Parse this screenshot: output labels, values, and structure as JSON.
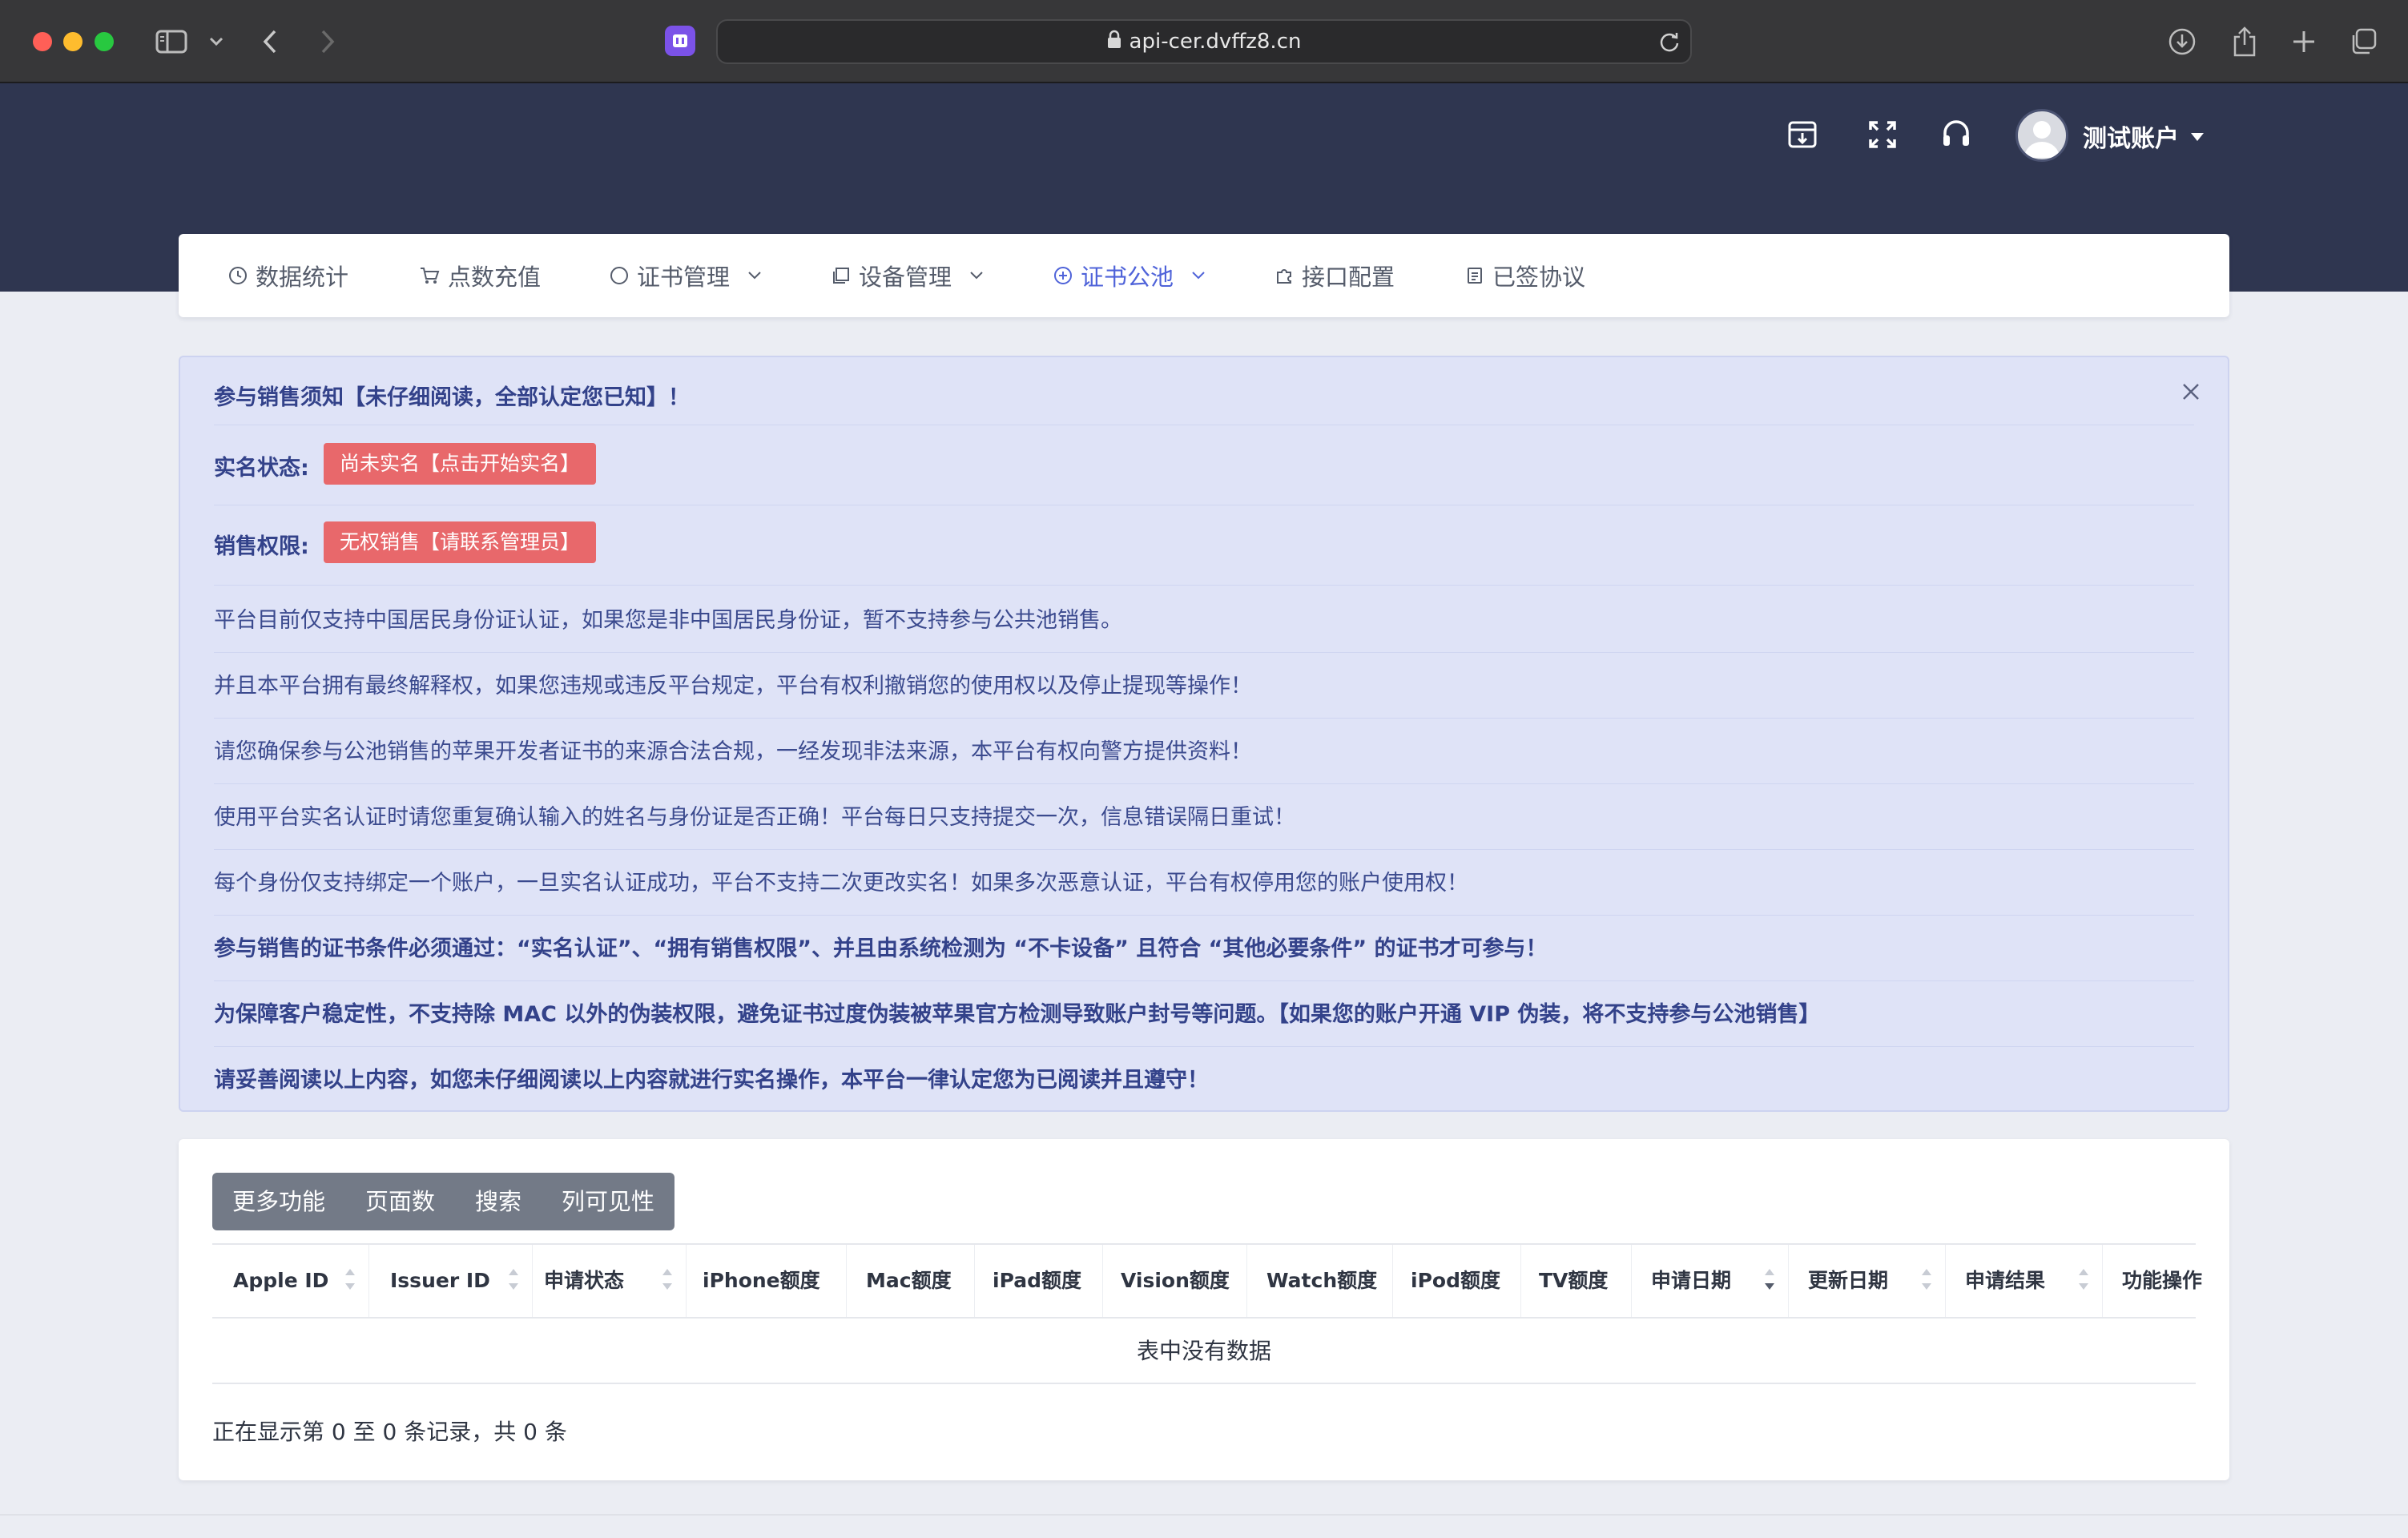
{
  "browser": {
    "url": "api-cer.dvffz8.cn"
  },
  "header": {
    "account_name": "测试账户"
  },
  "nav": {
    "items": [
      {
        "label": "数据统计",
        "icon": "clock-icon"
      },
      {
        "label": "点数充值",
        "icon": "cart-icon"
      },
      {
        "label": "证书管理",
        "icon": "circle-icon",
        "has_dropdown": true
      },
      {
        "label": "设备管理",
        "icon": "device-icon",
        "has_dropdown": true
      },
      {
        "label": "证书公池",
        "icon": "plus-circle-icon",
        "has_dropdown": true,
        "active": true
      },
      {
        "label": "接口配置",
        "icon": "puzzle-icon"
      },
      {
        "label": "已签协议",
        "icon": "document-icon"
      }
    ]
  },
  "notice": {
    "title": "参与销售须知【未仔细阅读，全部认定您已知】！",
    "realname_label": "实名状态:",
    "realname_badge": "尚未实名【点击开始实名】",
    "permission_label": "销售权限:",
    "permission_badge": "无权销售【请联系管理员】",
    "lines": [
      "平台目前仅支持中国居民身份证认证，如果您是非中国居民身份证，暂不支持参与公共池销售。",
      "并且本平台拥有最终解释权，如果您违规或违反平台规定，平台有权利撤销您的使用权以及停止提现等操作！",
      "请您确保参与公池销售的苹果开发者证书的来源合法合规，一经发现非法来源，本平台有权向警方提供资料！",
      "使用平台实名认证时请您重复确认输入的姓名与身份证是否正确！平台每日只支持提交一次，信息错误隔日重试！",
      "每个身份仅支持绑定一个账户，一旦实名认证成功，平台不支持二次更改实名！如果多次恶意认证，平台有权停用您的账户使用权！",
      "参与销售的证书条件必须通过：“实名认证”、“拥有销售权限”、并且由系统检测为 “不卡设备” 且符合 “其他必要条件” 的证书才可参与！",
      "为保障客户稳定性，不支持除 MAC 以外的伪装权限，避免证书过度伪装被苹果官方检测导致账户封号等问题。【如果您的账户开通 VIP 伪装，将不支持参与公池销售】",
      "请妥善阅读以上内容，如您未仔细阅读以上内容就进行实名操作，本平台一律认定您为已阅读并且遵守！"
    ]
  },
  "table": {
    "toolbar": [
      "更多功能",
      "页面数",
      "搜索",
      "列可见性"
    ],
    "columns": [
      "Apple ID",
      "Issuer ID",
      "申请状态",
      "iPhone额度",
      "Mac额度",
      "iPad额度",
      "Vision额度",
      "Watch额度",
      "iPod额度",
      "TV额度",
      "申请日期",
      "更新日期",
      "申请结果",
      "功能操作"
    ],
    "empty_text": "表中没有数据",
    "footer": "正在显示第 0 至 0 条记录，共 0 条"
  },
  "colors": {
    "header_bg": "#2f3650",
    "accent": "#4f63d9",
    "badge_red": "#e8686b",
    "notice_bg": "#dfe3f7"
  }
}
